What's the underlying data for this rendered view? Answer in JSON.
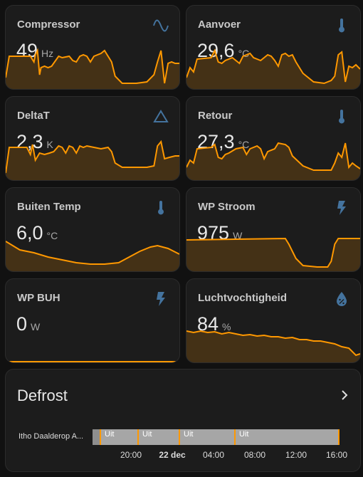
{
  "cards": [
    {
      "name": "Compressor",
      "value": "49",
      "unit": "Hz",
      "icon": "sine-wave-icon"
    },
    {
      "name": "Aanvoer",
      "value": "29,6",
      "unit": "°C",
      "icon": "thermometer-icon"
    },
    {
      "name": "DeltaT",
      "value": "2,3",
      "unit": "K",
      "icon": "triangle-icon"
    },
    {
      "name": "Retour",
      "value": "27,3",
      "unit": "°C",
      "icon": "thermometer-icon"
    },
    {
      "name": "Buiten Temp",
      "value": "6,0",
      "unit": "°C",
      "icon": "thermometer-icon"
    },
    {
      "name": "WP Stroom",
      "value": "975",
      "unit": "W",
      "icon": "lightning-bolt-icon"
    },
    {
      "name": "WP BUH",
      "value": "0",
      "unit": "W",
      "icon": "lightning-bolt-icon"
    },
    {
      "name": "Luchtvochtigheid",
      "value": "84",
      "unit": "%",
      "icon": "water-percent-icon"
    }
  ],
  "defrost": {
    "title": "Defrost",
    "entity": "Itho Daalderop A...",
    "states": [
      "Uit",
      "Uit",
      "Uit",
      "Uit"
    ],
    "ticks": [
      "20:00",
      "22 dec",
      "04:00",
      "08:00",
      "12:00",
      "16:00"
    ]
  },
  "colors": {
    "accent": "#ff9800",
    "icon": "#44739e",
    "card": "#1c1c1c",
    "background": "#111111"
  }
}
